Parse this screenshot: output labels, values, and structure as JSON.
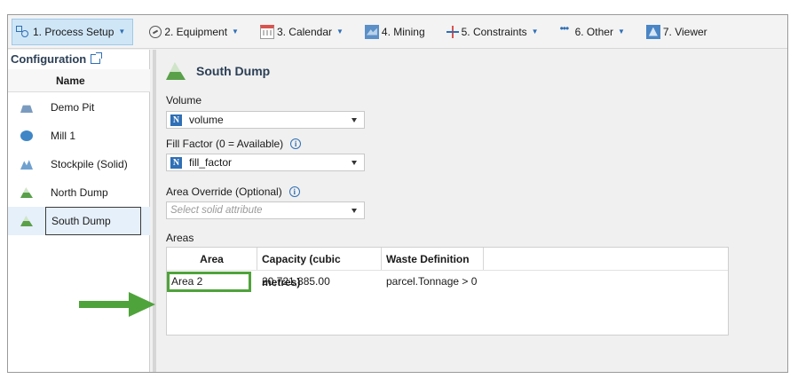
{
  "ribbon": {
    "tabs": [
      {
        "label": "1. Process Setup",
        "icon": "process-flow-icon",
        "caret": "▼"
      },
      {
        "label": "2. Equipment",
        "icon": "gauge-icon",
        "caret": "▼"
      },
      {
        "label": "3. Calendar",
        "icon": "calendar-icon",
        "caret": "▼"
      },
      {
        "label": "4. Mining",
        "icon": "mining-icon",
        "caret": ""
      },
      {
        "label": "5. Constraints",
        "icon": "constraints-icon",
        "caret": "▼"
      },
      {
        "label": "6. Other",
        "icon": "dots-icon",
        "caret": "▼"
      },
      {
        "label": "7. Viewer",
        "icon": "viewer-icon",
        "caret": ""
      }
    ]
  },
  "config": {
    "title": "Configuration",
    "column_header": "Name",
    "items": [
      {
        "label": "Demo Pit",
        "icon": "pit-icon"
      },
      {
        "label": "Mill 1",
        "icon": "mill-icon"
      },
      {
        "label": "Stockpile (Solid)",
        "icon": "stockpile-icon"
      },
      {
        "label": "North Dump",
        "icon": "dump-icon"
      },
      {
        "label": "South Dump",
        "icon": "dump-icon",
        "selected": true
      }
    ]
  },
  "detail": {
    "title": "South Dump",
    "volume": {
      "label": "Volume",
      "value": "volume",
      "badge": "N"
    },
    "fill_factor": {
      "label": "Fill Factor (0 = Available)",
      "value": "fill_factor",
      "badge": "N",
      "info": "i"
    },
    "area_override": {
      "label": "Area Override (Optional)",
      "placeholder": "Select solid attribute",
      "info": "i"
    },
    "areas": {
      "label": "Areas",
      "columns": [
        "Area",
        "Capacity (cubic metres)",
        "Waste Definition"
      ],
      "rows": [
        {
          "area": "Area 2",
          "capacity": "20,721,885.00",
          "waste": "parcel.Tonnage > 0"
        }
      ]
    }
  },
  "colors": {
    "accent": "#2f6fb5",
    "highlight": "#4fa33b",
    "selected_tab": "#cfe6f7"
  }
}
